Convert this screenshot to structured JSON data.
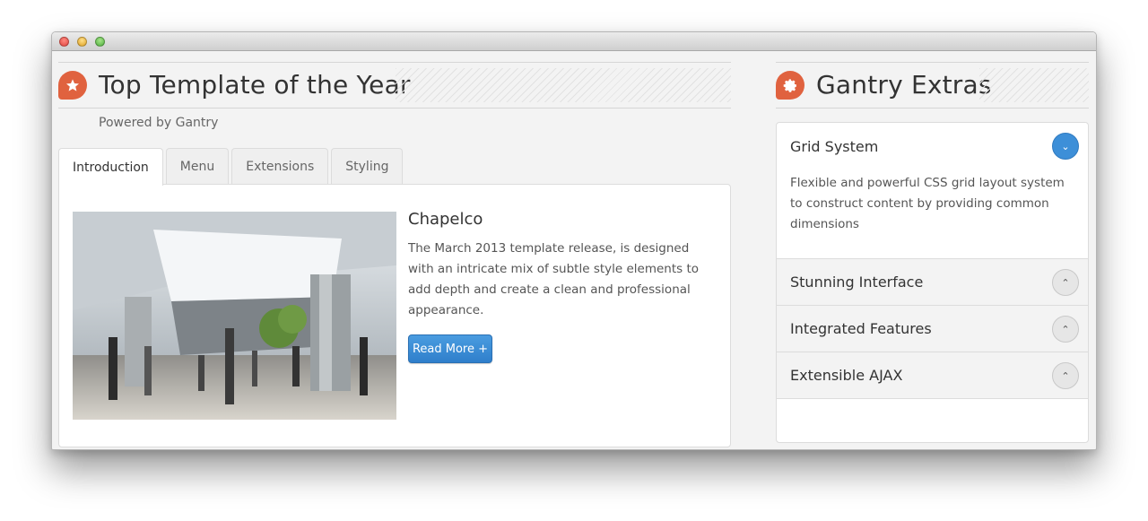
{
  "window": {
    "controls": [
      "close",
      "minimize",
      "zoom"
    ]
  },
  "main": {
    "title": "Top Template of the Year",
    "title_icon": "star-icon",
    "subtitle": "Powered by Gantry",
    "tabs": [
      {
        "label": "Introduction",
        "active": true
      },
      {
        "label": "Menu",
        "active": false
      },
      {
        "label": "Extensions",
        "active": false
      },
      {
        "label": "Styling",
        "active": false
      }
    ],
    "article": {
      "title": "Chapelco",
      "body": "The March 2013 template release, is designed with an intricate mix of subtle style elements to add depth and create a clean and professional appearance.",
      "button": "Read More +"
    }
  },
  "sidebar": {
    "title": "Gantry Extras",
    "title_icon": "gear-icon",
    "accordion": [
      {
        "label": "Grid System",
        "expanded": true,
        "body": "Flexible and powerful CSS grid layout system to construct content by providing common dimensions"
      },
      {
        "label": "Stunning Interface",
        "expanded": false
      },
      {
        "label": "Integrated Features",
        "expanded": false
      },
      {
        "label": "Extensible AJAX",
        "expanded": false
      }
    ]
  },
  "colors": {
    "accent_orange": "#e0623f",
    "button_blue": "#3d8fd8",
    "window_bg": "#f3f3f3"
  }
}
